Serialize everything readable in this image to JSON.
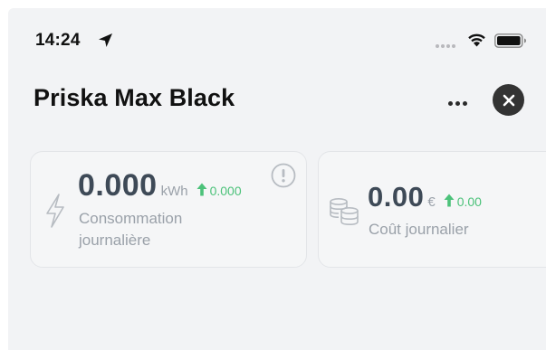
{
  "status_bar": {
    "time": "14:24",
    "icons": [
      "location-arrow-icon",
      "signal-dots-icon",
      "wifi-icon",
      "battery-icon"
    ]
  },
  "header": {
    "title": "Priska Max Black",
    "actions": [
      "more-icon",
      "close-icon"
    ]
  },
  "cards": [
    {
      "icon": "lightning-icon",
      "value": "0.000",
      "unit": "kWh",
      "trend": "0.000",
      "trend_direction": "up",
      "label": "Consommation journalière",
      "badge_icon": "info-icon"
    },
    {
      "icon": "coins-icon",
      "value": "0.00",
      "unit": "€",
      "trend": "0.00",
      "trend_direction": "up",
      "label": "Coût journalier"
    }
  ],
  "colors": {
    "background": "#f2f3f5",
    "card_background": "#f5f6f7",
    "value_text": "#3e4a57",
    "muted_text": "#9aa1a9",
    "trend_up": "#4cc27a",
    "close_button": "#333333"
  }
}
